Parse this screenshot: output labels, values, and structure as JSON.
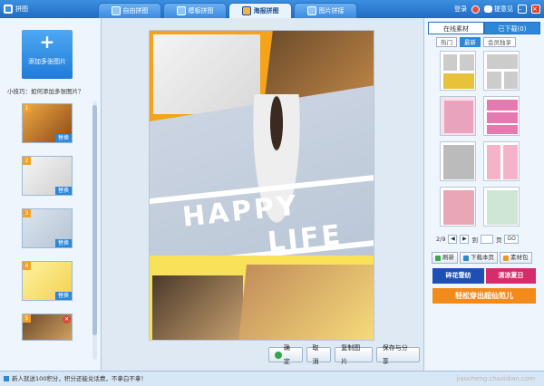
{
  "app": {
    "name": "拼图"
  },
  "tabs": [
    {
      "label": "自由拼图",
      "active": false
    },
    {
      "label": "模板拼图",
      "active": false
    },
    {
      "label": "海报拼图",
      "active": true
    },
    {
      "label": "图片拼接",
      "active": false
    }
  ],
  "titlebar": {
    "login": "登录",
    "feedback": "提意见",
    "min": "–",
    "close": "×"
  },
  "left": {
    "add_label": "添加多张图片",
    "tip": "小技巧：如何添加多张图片？",
    "thumbs": [
      {
        "num": "1",
        "replace": "替换"
      },
      {
        "num": "2",
        "replace": "替换"
      },
      {
        "num": "3",
        "replace": "替换"
      },
      {
        "num": "4",
        "replace": "替换"
      },
      {
        "num": "5",
        "replace": ""
      }
    ]
  },
  "poster": {
    "happy": "HAPPY",
    "life": "LIFE"
  },
  "actions": {
    "ok": "确定",
    "cancel": "取消",
    "copy": "复制图片",
    "save": "保存与分享"
  },
  "right": {
    "tabs": [
      "在线素材",
      "已下载(0)"
    ],
    "subtabs": [
      "热门",
      "最新",
      "会员独享"
    ],
    "page": "2/9",
    "to_label": "到",
    "page_label": "页",
    "go": "GO",
    "refresh": "刷新",
    "download_page": "下载本页",
    "package": "素材包",
    "ad1": "碎花雪纺",
    "ad2": "清凉夏日",
    "ad3": "轻松穿出超仙范儿"
  },
  "status": {
    "text": "新人就送100积分，积分还能兑话费，不拿白不拿！"
  },
  "watermark": "jiaocheng.chazidian.com"
}
